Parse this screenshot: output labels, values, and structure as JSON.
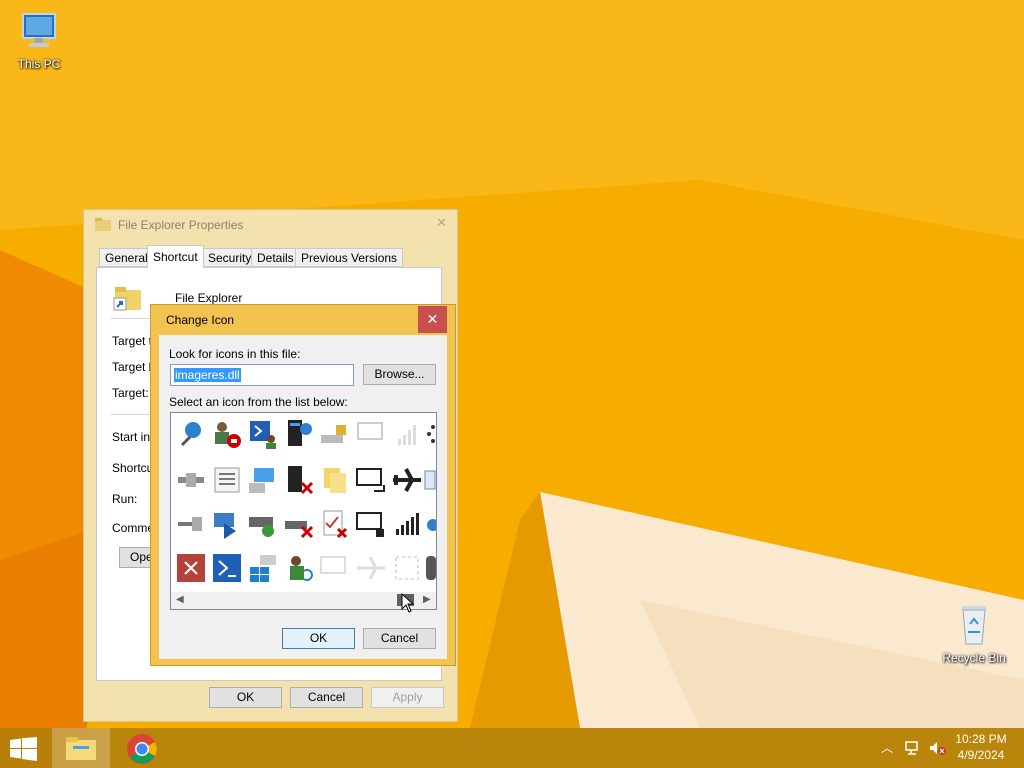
{
  "desktop": {
    "this_pc_label": "This PC",
    "recycle_bin_label": "Recycle Bin"
  },
  "properties_window": {
    "title": "File Explorer Properties",
    "tabs": [
      "General",
      "Shortcut",
      "Security",
      "Details",
      "Previous Versions"
    ],
    "active_tab": "Shortcut",
    "name": "File Explorer",
    "fields": {
      "target_type": "Target ty",
      "target_location": "Target lo",
      "target": "Target:",
      "start_in": "Start in:",
      "shortcut_key": "Shortcut",
      "run": "Run:",
      "comment": "Commen"
    },
    "open_button": "Open",
    "ok_label": "OK",
    "cancel_label": "Cancel",
    "apply_label": "Apply"
  },
  "change_icon_dialog": {
    "title": "Change Icon",
    "look_label": "Look for icons in this file:",
    "file_value": "imageres.dll",
    "browse_label": "Browse...",
    "select_label": "Select an icon from the list below:",
    "ok_label": "OK",
    "cancel_label": "Cancel",
    "scroll_position": 0.92
  },
  "taskbar": {
    "time": "10:28 PM",
    "date": "4/9/2024",
    "tray_icons": [
      "chevron-up-icon",
      "network-icon",
      "volume-muted-icon"
    ]
  },
  "colors": {
    "wallpaper": "#f5a800",
    "dialog_frame": "#f3c350",
    "close_button": "#c7504f",
    "selection": "#3399ff"
  }
}
